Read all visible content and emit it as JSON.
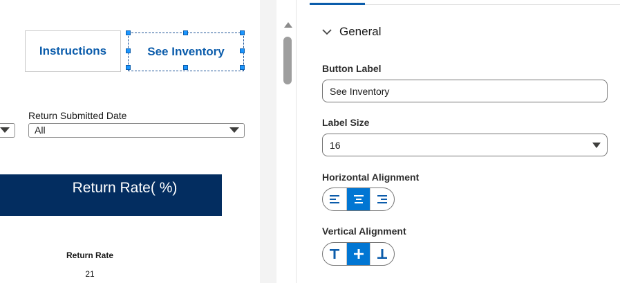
{
  "canvas": {
    "buttons": {
      "instructions": "Instructions",
      "see_inventory": "See Inventory"
    },
    "filter": {
      "label": "Return Submitted Date",
      "value": "All"
    },
    "banner": {
      "title": "Return Rate( %)"
    },
    "metric": {
      "label": "Return Rate",
      "value": "21"
    }
  },
  "panel": {
    "section": {
      "title": "General",
      "expanded": true
    },
    "button_label": {
      "label": "Button Label",
      "value": "See Inventory"
    },
    "label_size": {
      "label": "Label Size",
      "value": "16"
    },
    "horizontal_alignment": {
      "label": "Horizontal Alignment",
      "options": [
        "align-left-icon",
        "align-center-icon",
        "align-right-icon"
      ],
      "selected": "center"
    },
    "vertical_alignment": {
      "label": "Vertical Alignment",
      "options": [
        "align-top-icon",
        "align-middle-icon",
        "align-bottom-icon"
      ],
      "selected": "middle"
    }
  },
  "colors": {
    "accent": "#0176d3",
    "brand_blue": "#0b5cab",
    "banner_bg": "#032d60",
    "selection_handle": "#1b96ff"
  }
}
